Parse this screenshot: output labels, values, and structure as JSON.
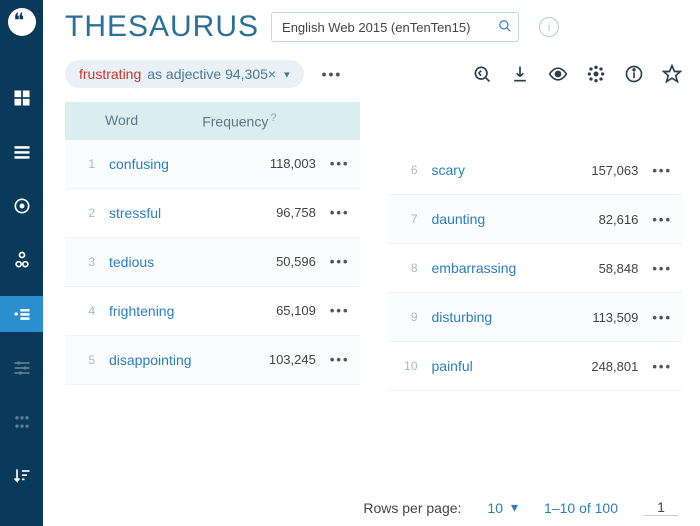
{
  "title": "THESAURUS",
  "corpus": "English Web 2015 (enTenTen15)",
  "chip": {
    "word": "frustrating",
    "rest": "as adjective 94,305×"
  },
  "headers": {
    "word": "Word",
    "freq": "Frequency",
    "help": "?"
  },
  "left": [
    {
      "rank": "1",
      "word": "confusing",
      "freq": "118,003"
    },
    {
      "rank": "2",
      "word": "stressful",
      "freq": "96,758"
    },
    {
      "rank": "3",
      "word": "tedious",
      "freq": "50,596"
    },
    {
      "rank": "4",
      "word": "frightening",
      "freq": "65,109"
    },
    {
      "rank": "5",
      "word": "disappointing",
      "freq": "103,245"
    }
  ],
  "right": [
    {
      "rank": "6",
      "word": "scary",
      "freq": "157,063"
    },
    {
      "rank": "7",
      "word": "daunting",
      "freq": "82,616"
    },
    {
      "rank": "8",
      "word": "embarrassing",
      "freq": "58,848"
    },
    {
      "rank": "9",
      "word": "disturbing",
      "freq": "113,509"
    },
    {
      "rank": "10",
      "word": "painful",
      "freq": "248,801"
    }
  ],
  "footer": {
    "rows_label": "Rows per page:",
    "rows_value": "10",
    "range": "1–10 of 100",
    "page": "1"
  }
}
